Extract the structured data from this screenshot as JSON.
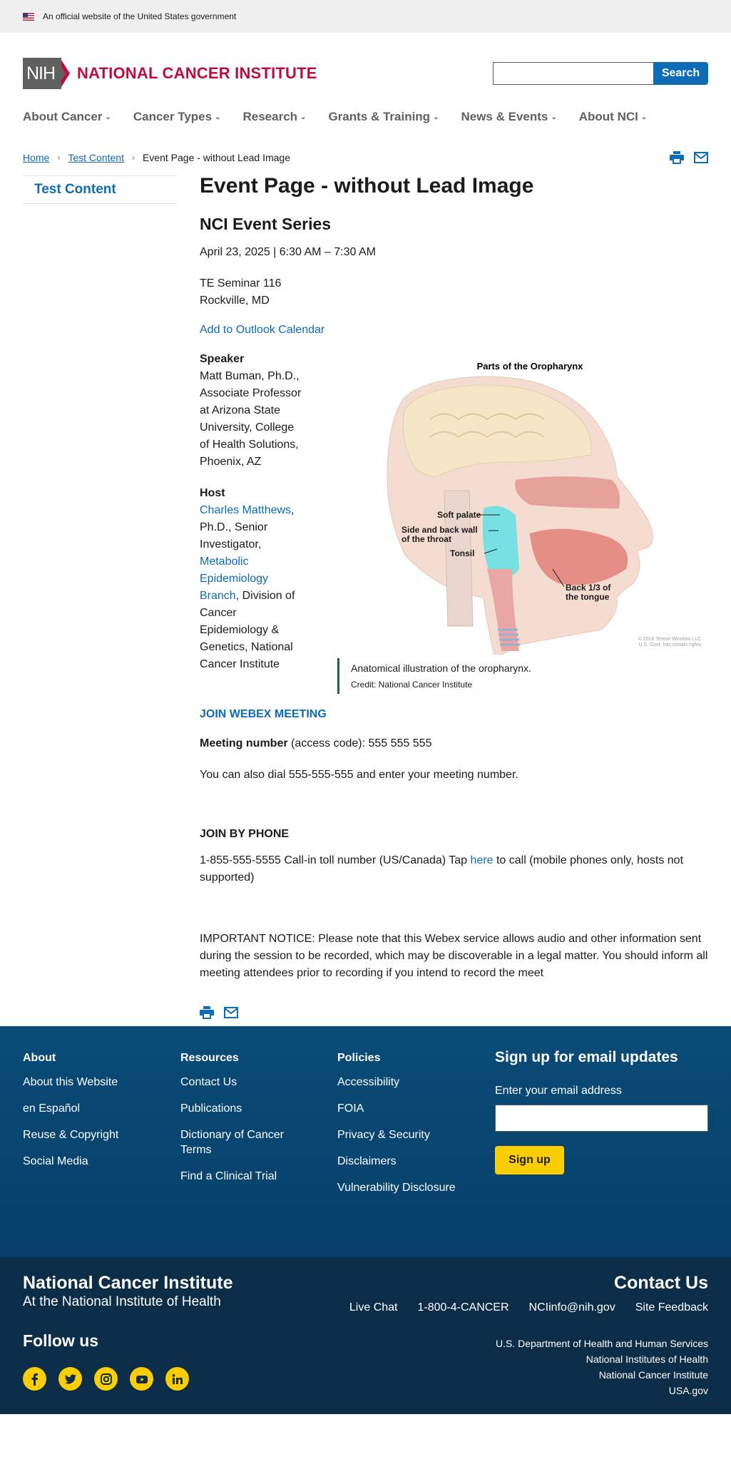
{
  "gov_banner": {
    "text": "An official website of the United States government"
  },
  "header": {
    "nih_label": "NIH",
    "institute_name": "NATIONAL CANCER INSTITUTE",
    "search_placeholder": "",
    "search_button": "Search"
  },
  "nav": {
    "items": [
      {
        "label": "About Cancer"
      },
      {
        "label": "Cancer Types"
      },
      {
        "label": "Research"
      },
      {
        "label": "Grants & Training"
      },
      {
        "label": "News & Events"
      },
      {
        "label": "About NCI"
      }
    ]
  },
  "breadcrumb": {
    "home": "Home",
    "section": "Test Content",
    "current": "Event Page - without Lead Image"
  },
  "sidebar": {
    "link": "Test Content"
  },
  "event": {
    "title": "Event Page - without Lead Image",
    "series": "NCI Event Series",
    "date": "April 23, 2025 | 6:30 AM – 7:30 AM",
    "location_line1": "TE Seminar 116",
    "location_line2": "Rockville, MD",
    "calendar_link": "Add to Outlook Calendar",
    "speaker_heading": "Speaker",
    "speaker_text": "Matt Buman, Ph.D., Associate Professor at Arizona State University, College of Health Solutions, Phoenix, AZ",
    "host_heading": "Host",
    "host_name": "Charles Matthews",
    "host_title": ", Ph.D., Senior Investigator, ",
    "host_branch": "Metabolic Epidemiology Branch",
    "host_rest": ", Division of Cancer Epidemiology & Genetics, National Cancer Institute",
    "figure": {
      "heading": "Parts of the Oropharynx",
      "label_soft_palate": "Soft palate",
      "label_wall_1": "Side and back wall",
      "label_wall_2": "of the throat",
      "label_tonsil": "Tonsil",
      "label_tongue_1": "Back 1/3 of",
      "label_tongue_2": "the tongue",
      "copyright_1": "© 2016 Terese Winslow LLC",
      "copyright_2": "U.S. Govt. has certain rights",
      "caption": "Anatomical illustration of the oropharynx.",
      "credit": "Credit: National Cancer Institute"
    },
    "webex_link": "JOIN WEBEX MEETING",
    "meeting_label": "Meeting number",
    "meeting_rest": " (access code): 555 555 555",
    "dial_text": "You can also dial 555-555-555 and enter your meeting number.",
    "phone_heading": "JOIN BY PHONE",
    "phone_text_1": "1-855-555-5555 Call-in toll number (US/Canada) Tap ",
    "phone_link": "here",
    "phone_text_2": " to call (mobile phones only, hosts not supported)",
    "notice": "IMPORTANT NOTICE: Please note that this Webex service allows audio and other information sent during the session to be recorded, which may be discoverable in a legal matter. You should inform all meeting attendees prior to recording if you intend to record the meet"
  },
  "footer": {
    "about": {
      "heading": "About",
      "links": [
        "About this Website",
        "en Español",
        "Reuse & Copyright",
        "Social Media"
      ]
    },
    "resources": {
      "heading": "Resources",
      "links": [
        "Contact Us",
        "Publications",
        "Dictionary of Cancer Terms",
        "Find a Clinical Trial"
      ]
    },
    "policies": {
      "heading": "Policies",
      "links": [
        "Accessibility",
        "FOIA",
        "Privacy & Security",
        "Disclaimers",
        "Vulnerability Disclosure"
      ]
    },
    "signup": {
      "heading": "Sign up for email updates",
      "label": "Enter your email address",
      "button": "Sign up"
    },
    "org_name": "National Cancer Institute",
    "org_sub": "At the National Institute of Health",
    "contact_heading": "Contact Us",
    "contact_links": [
      "Live Chat",
      "1-800-4-CANCER",
      "NCIinfo@nih.gov",
      "Site Feedback"
    ],
    "follow_heading": "Follow us",
    "agencies": [
      "U.S. Department of Health and Human Services",
      "National Institutes of Health",
      "National Cancer Institute",
      "USA.gov"
    ]
  },
  "colors": {
    "brand_red": "#bb0e3d",
    "link_blue": "#0e6bb5",
    "footer_blue": "#07456f",
    "footer_dark": "#0c2d48",
    "accent_yellow": "#face00"
  }
}
